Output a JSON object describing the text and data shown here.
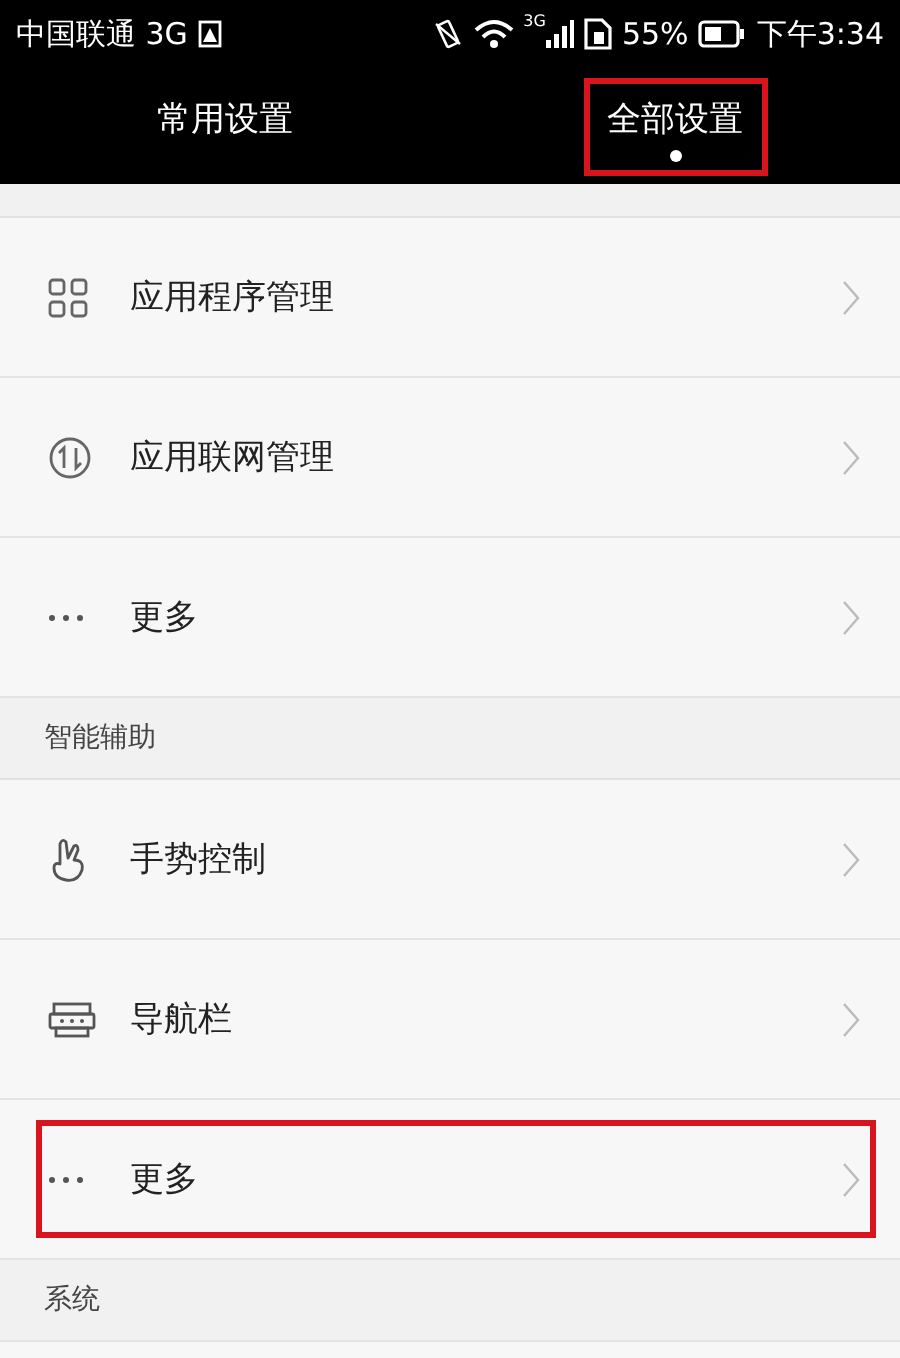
{
  "status_bar": {
    "carrier": "中国联通 3G",
    "network": "3G",
    "battery": "55%",
    "time": "下午3:34"
  },
  "tabs": [
    {
      "label": "常用设置",
      "selected": false,
      "highlighted": false
    },
    {
      "label": "全部设置",
      "selected": true,
      "highlighted": true
    }
  ],
  "sections": [
    {
      "items": [
        {
          "kind": "apps",
          "label": "应用程序管理",
          "highlighted": false
        },
        {
          "kind": "network",
          "label": "应用联网管理",
          "highlighted": false
        },
        {
          "kind": "more",
          "label": "更多",
          "highlighted": false
        }
      ]
    },
    {
      "title": "智能辅助",
      "items": [
        {
          "kind": "gesture",
          "label": "手势控制",
          "highlighted": false
        },
        {
          "kind": "navbar",
          "label": "导航栏",
          "highlighted": false
        },
        {
          "kind": "more",
          "label": "更多",
          "highlighted": true
        }
      ]
    },
    {
      "title": "系统"
    }
  ]
}
